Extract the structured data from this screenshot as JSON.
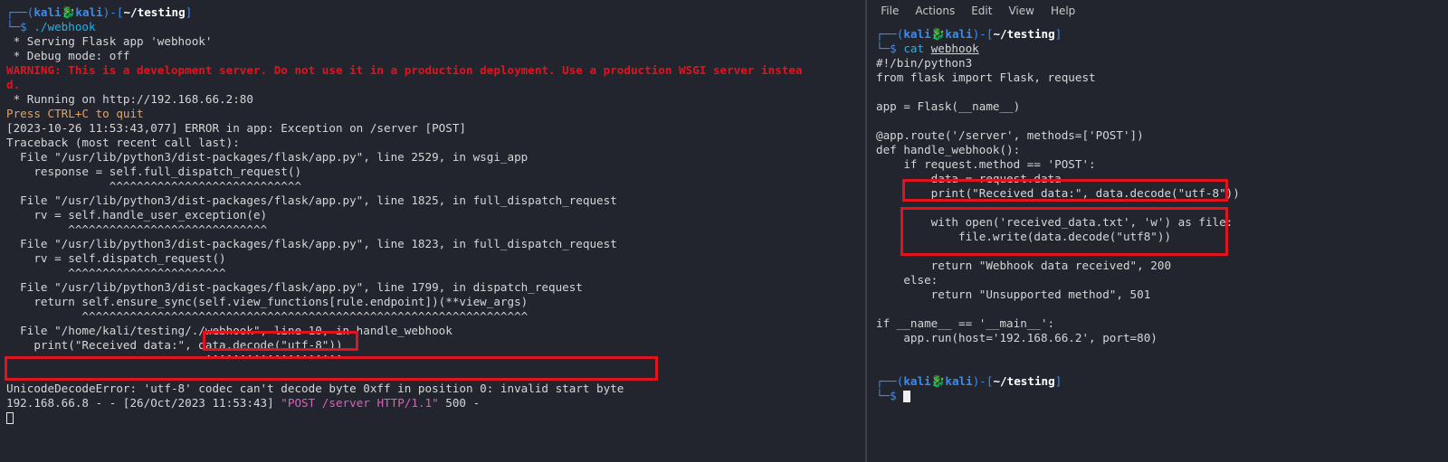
{
  "colors": {
    "background": "#22252d",
    "prompt_frame": "#3c8cf0",
    "user": "#3c8cf0",
    "command": "#1fb3e8",
    "warning": "#e0141e",
    "highlight_box": "#e0141e",
    "notice": "#e9a05a",
    "request": "#e15ec0"
  },
  "icons": {
    "prompt_separator": "kali-dragon-icon"
  },
  "left_terminal": {
    "prompt_top": "┌──(",
    "prompt_user": "kali",
    "prompt_sep": "🐉",
    "prompt_host": "kali",
    "prompt_mid": ")-[",
    "prompt_path": "~/testing",
    "prompt_end": "]",
    "prompt_bottom": "└─$",
    "command": "./webhook",
    "output": [
      " * Serving Flask app 'webhook'",
      " * Debug mode: off"
    ],
    "warning_1": "WARNING: This is a development server. Do not use it in a production deployment. Use a production WSGI server instea",
    "warning_2": "d.",
    "running": " * Running on http://192.168.66.2:80",
    "press_quit": "Press CTRL+C to quit",
    "traceback": [
      "[2023-10-26 11:53:43,077] ERROR in app: Exception on /server [POST]",
      "Traceback (most recent call last):",
      "  File \"/usr/lib/python3/dist-packages/flask/app.py\", line 2529, in wsgi_app",
      "    response = self.full_dispatch_request()",
      "               ^^^^^^^^^^^^^^^^^^^^^^^^^^^^",
      "  File \"/usr/lib/python3/dist-packages/flask/app.py\", line 1825, in full_dispatch_request",
      "    rv = self.handle_user_exception(e)",
      "         ^^^^^^^^^^^^^^^^^^^^^^^^^^^^^",
      "  File \"/usr/lib/python3/dist-packages/flask/app.py\", line 1823, in full_dispatch_request",
      "    rv = self.dispatch_request()",
      "         ^^^^^^^^^^^^^^^^^^^^^^^",
      "  File \"/usr/lib/python3/dist-packages/flask/app.py\", line 1799, in dispatch_request",
      "    return self.ensure_sync(self.view_functions[rule.endpoint])(**view_args)",
      "           ^^^^^^^^^^^^^^^^^^^^^^^^^^^^^^^^^^^^^^^^^^^^^^^^^^^^^^^^^^^^^^^^^",
      "  File \"/home/kali/testing/./webhook\", line 10, in handle_webhook",
      "    print(\"Received data:\", data.decode(\"utf-8\"))",
      "                             ^^^^^^^^^^^^^^^^^^^^",
      "",
      "UnicodeDecodeError: 'utf-8' codec can't decode byte 0xff in position 0: invalid start byte"
    ],
    "access_prefix": "192.168.66.8 - - [26/Oct/2023 11:53:43] ",
    "access_request": "\"POST /server HTTP/1.1\"",
    "access_suffix": " 500 -"
  },
  "right_terminal": {
    "menu": [
      "File",
      "Actions",
      "Edit",
      "View",
      "Help"
    ],
    "prompt_top": "┌──(",
    "prompt_user": "kali",
    "prompt_sep": "🐉",
    "prompt_host": "kali",
    "prompt_mid": ")-[",
    "prompt_path": "~/testing",
    "prompt_end": "]",
    "prompt_bottom": "└─$",
    "command_name": "cat",
    "command_arg": "webhook",
    "code": [
      "#!/bin/python3",
      "from flask import Flask, request",
      "",
      "app = Flask(__name__)",
      "",
      "@app.route('/server', methods=['POST'])",
      "def handle_webhook():",
      "    if request.method == 'POST':",
      "        data = request.data",
      "        print(\"Received data:\", data.decode(\"utf-8\"))",
      "",
      "        with open('received_data.txt', 'w') as file:",
      "            file.write(data.decode(\"utf8\"))",
      "",
      "        return \"Webhook data received\", 200",
      "    else:",
      "        return \"Unsupported method\", 501",
      "",
      "if __name__ == '__main__':",
      "    app.run(host='192.168.66.2', port=80)",
      "",
      ""
    ]
  }
}
